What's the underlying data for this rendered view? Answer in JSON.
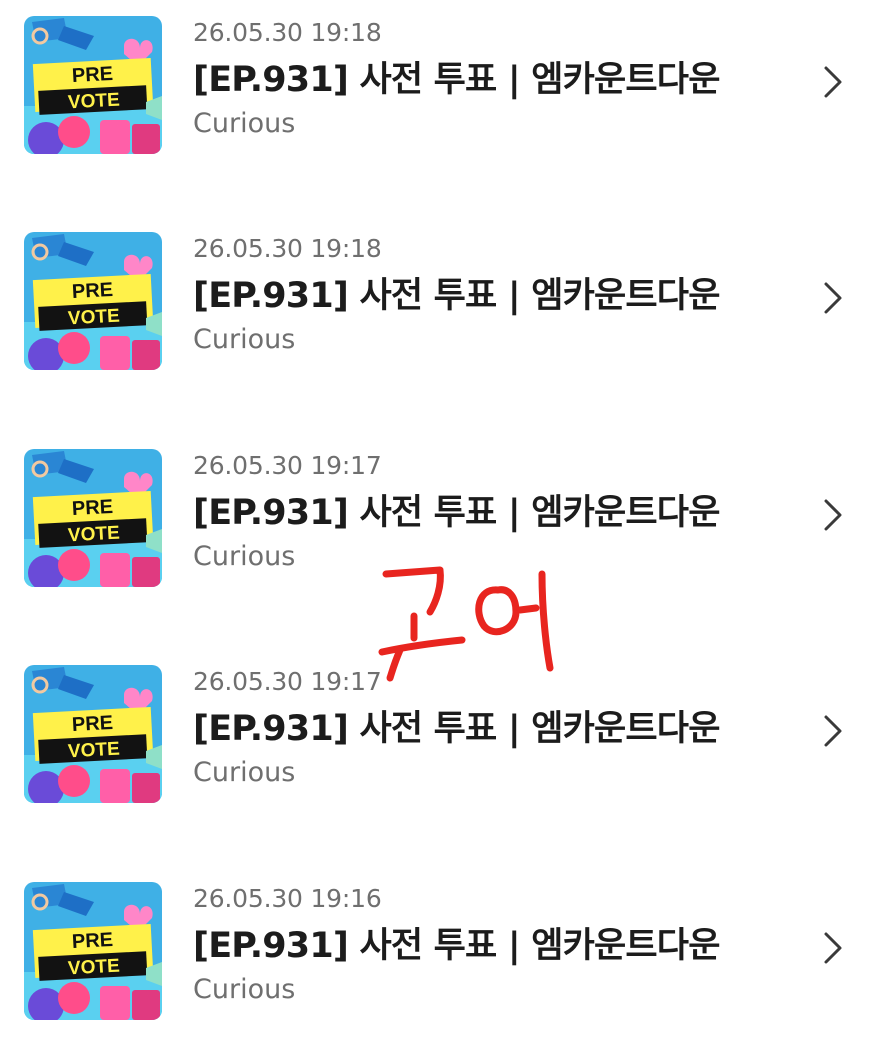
{
  "list": {
    "items": [
      {
        "date": "26.05.30 19:18",
        "title": "[EP.931] 사전 투표 | 엠카운트다운",
        "subtitle": "Curious"
      },
      {
        "date": "26.05.30 19:18",
        "title": "[EP.931] 사전 투표 | 엠카운트다운",
        "subtitle": "Curious"
      },
      {
        "date": "26.05.30 19:17",
        "title": "[EP.931] 사전 투표 | 엠카운트다운",
        "subtitle": "Curious"
      },
      {
        "date": "26.05.30 19:17",
        "title": "[EP.931] 사전 투표 | 엠카운트다운",
        "subtitle": "Curious"
      },
      {
        "date": "26.05.30 19:16",
        "title": "[EP.931] 사전 투표 | 엠카운트다운",
        "subtitle": "Curious"
      }
    ]
  },
  "thumbnail": {
    "line1": "PRE",
    "line2": "VOTE"
  },
  "annotation": {
    "handwritten_text": "코어",
    "color": "#e8251f"
  },
  "icons": {
    "row_chevron": "chevron-right-icon"
  }
}
